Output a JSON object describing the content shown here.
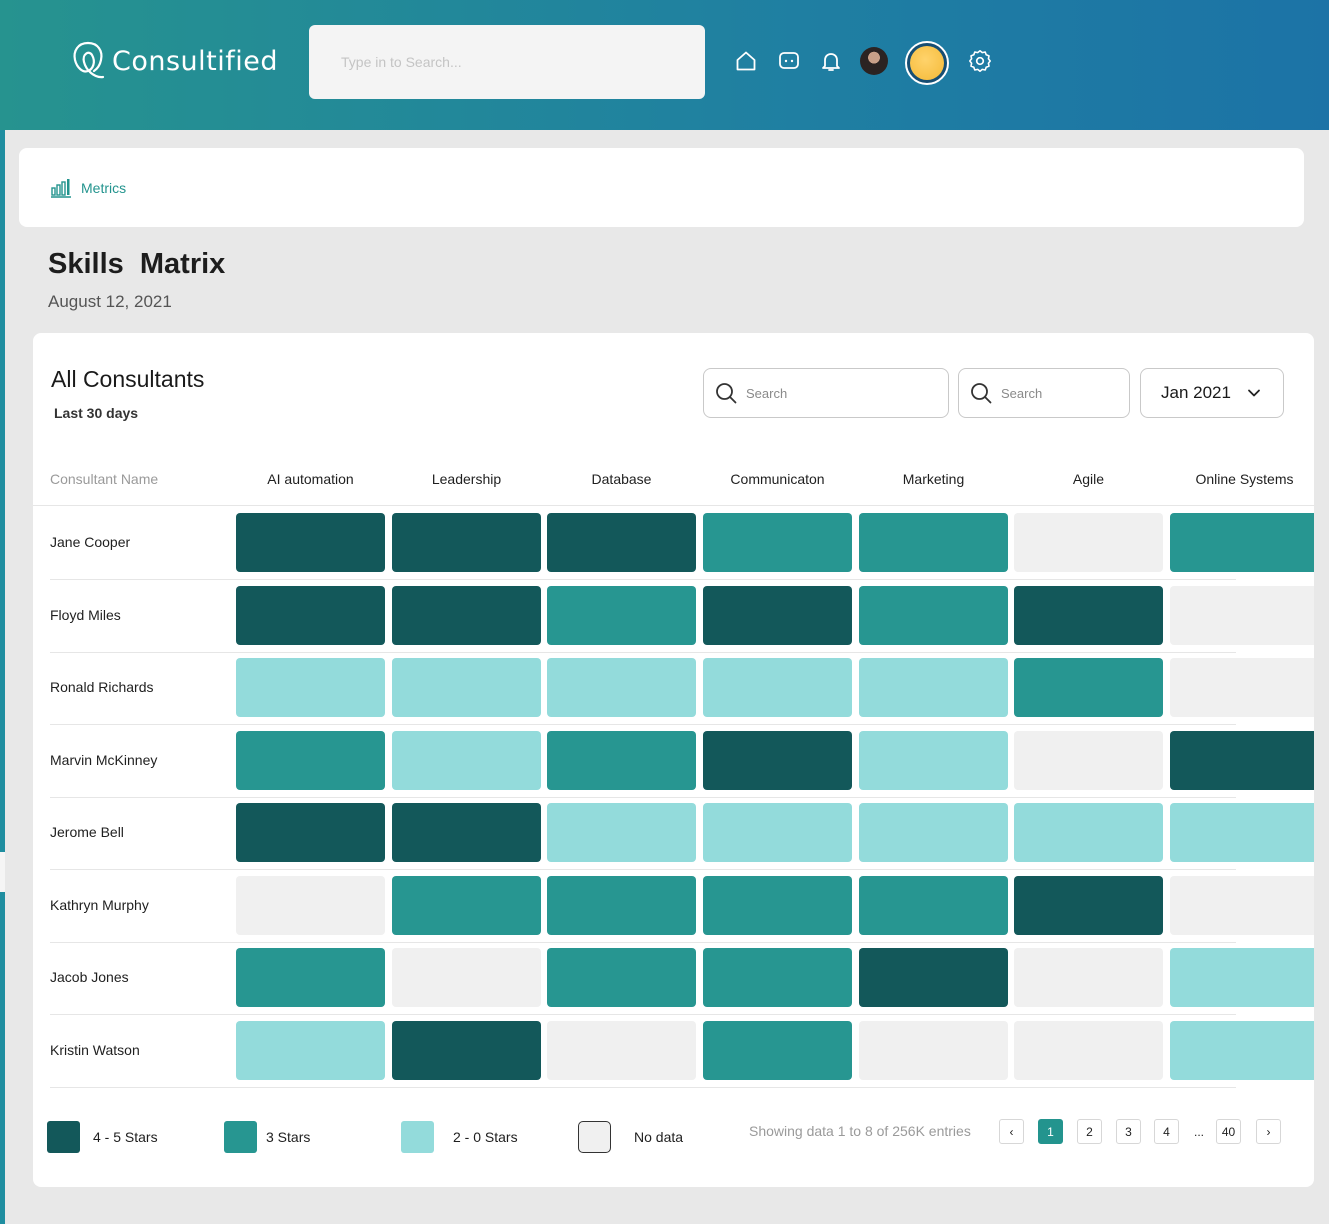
{
  "app": {
    "brand": "Consultified",
    "search_placeholder": "Type in to Search...",
    "colors": {
      "header_start": "#26938f",
      "header_end": "#1c73a6",
      "accent": "#23948e"
    },
    "icons": [
      "home-icon",
      "chat-icon",
      "bell-icon",
      "user-avatar",
      "theme-avatar",
      "gear-icon"
    ]
  },
  "breadcrumb": {
    "label": "Metrics",
    "icon": "bar-chart-icon"
  },
  "page": {
    "title": "Skills  Matrix",
    "date": "August 12, 2021"
  },
  "card": {
    "title": "All Consultants",
    "subtitle": "Last 30 days",
    "search1_placeholder": "Search",
    "search2_placeholder": "Search",
    "month": "Jan 2021"
  },
  "table": {
    "name_header": "Consultant Name",
    "columns": [
      "AI automation",
      "Leadership",
      "Database",
      "Communicaton",
      "Marketing",
      "Agile",
      "Online Systems"
    ],
    "rows": [
      {
        "name": "Jane Cooper",
        "levels": [
          "4-5",
          "4-5",
          "4-5",
          "3",
          "3",
          "none",
          "3"
        ]
      },
      {
        "name": "Floyd Miles",
        "levels": [
          "4-5",
          "4-5",
          "3",
          "4-5",
          "3",
          "4-5",
          "none"
        ]
      },
      {
        "name": "Ronald Richards",
        "levels": [
          "2-0",
          "2-0",
          "2-0",
          "2-0",
          "2-0",
          "3",
          "none"
        ]
      },
      {
        "name": "Marvin McKinney",
        "levels": [
          "3",
          "2-0",
          "3",
          "4-5",
          "2-0",
          "none",
          "4-5"
        ]
      },
      {
        "name": "Jerome Bell",
        "levels": [
          "4-5",
          "4-5",
          "2-0",
          "2-0",
          "2-0",
          "2-0",
          "2-0"
        ]
      },
      {
        "name": "Kathryn Murphy",
        "levels": [
          "none",
          "3",
          "3",
          "3",
          "3",
          "4-5",
          "none"
        ]
      },
      {
        "name": "Jacob Jones",
        "levels": [
          "3",
          "none",
          "3",
          "3",
          "4-5",
          "none",
          "2-0"
        ]
      },
      {
        "name": "Kristin Watson",
        "levels": [
          "2-0",
          "4-5",
          "none",
          "3",
          "none",
          "none",
          "2-0"
        ]
      }
    ]
  },
  "legend": [
    {
      "label": "4 - 5 Stars",
      "color": "#13585a"
    },
    {
      "label": "3  Stars",
      "color": "#279691"
    },
    {
      "label": "2 - 0 Stars",
      "color": "#93dbdb"
    },
    {
      "label": "No data",
      "color": "#f0f0f0"
    }
  ],
  "pagination": {
    "summary": "Showing data 1 to 8 of  256K entries",
    "prev": "‹",
    "pages": [
      "1",
      "2",
      "3",
      "4"
    ],
    "ellipsis": "...",
    "last": "40",
    "next": "›",
    "active": "1"
  }
}
